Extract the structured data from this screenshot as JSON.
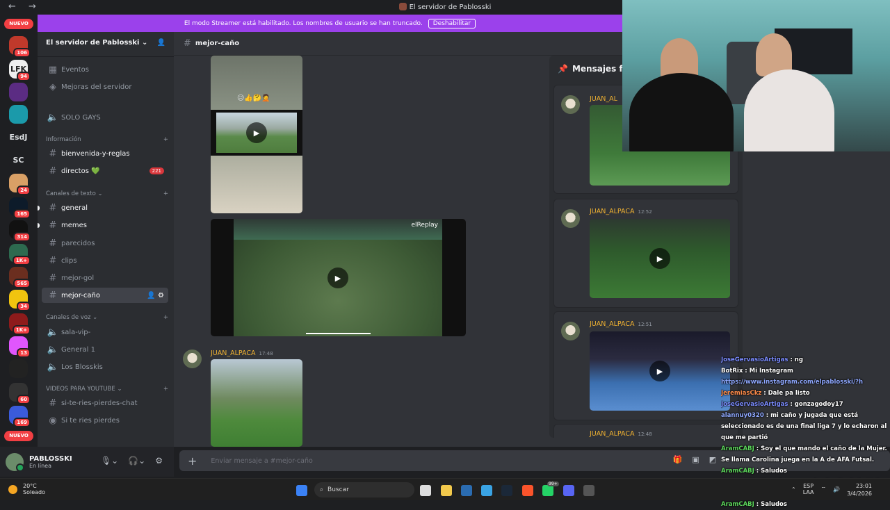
{
  "window": {
    "title": "El servidor de Pablosski",
    "back": "←",
    "forward": "→"
  },
  "guilds": {
    "new_label_top": "NUEVO",
    "new_label_bottom": "NUEVO",
    "items": [
      {
        "label": "",
        "badge": "106",
        "color": "#c0392b"
      },
      {
        "label": "LFK",
        "badge": "94",
        "color": "#eeeeee"
      },
      {
        "label": "",
        "badge": "",
        "color": "#5b2c83"
      },
      {
        "label": "",
        "badge": "",
        "color": "#1b9aaa"
      },
      {
        "label": "EsdJ",
        "badge": "",
        "color": "#1e1f22"
      },
      {
        "label": "SC",
        "badge": "",
        "color": "#1e1f22"
      },
      {
        "label": "",
        "badge": "24",
        "color": "#d9a066"
      },
      {
        "label": "",
        "badge": "165",
        "color": "#0d1b2a"
      },
      {
        "label": "",
        "badge": "314",
        "color": "#111111"
      },
      {
        "label": "",
        "badge": "1K+",
        "color": "#2d6a4f"
      },
      {
        "label": "",
        "badge": "565",
        "color": "#6b2e1f"
      },
      {
        "label": "",
        "badge": "34",
        "color": "#f1c40f"
      },
      {
        "label": "",
        "badge": "1K+",
        "color": "#8e1b1b"
      },
      {
        "label": "",
        "badge": "13",
        "color": "#e056fd"
      },
      {
        "label": "",
        "badge": "",
        "color": "#222222"
      },
      {
        "label": "",
        "badge": "60",
        "color": "#333333"
      },
      {
        "label": "",
        "badge": "169",
        "color": "#3b5bdb"
      }
    ]
  },
  "server": {
    "name": "El servidor de Pablosski",
    "events": "Eventos",
    "boosts": "Mejoras del servidor",
    "channels_top": [
      {
        "name": "SOLO GAYS",
        "type": "voice"
      }
    ],
    "categories": [
      {
        "name": "Información",
        "channels": [
          {
            "name": "bienvenida-y-reglas",
            "bright": true
          },
          {
            "name": "directos 💚",
            "bright": true,
            "mentions": "221"
          }
        ]
      },
      {
        "name": "Canales de texto",
        "channels": [
          {
            "name": "general",
            "bright": true
          },
          {
            "name": "memes",
            "bright": true
          },
          {
            "name": "parecidos"
          },
          {
            "name": "clips"
          },
          {
            "name": "mejor-gol"
          },
          {
            "name": "mejor-caño",
            "selected": true
          }
        ]
      },
      {
        "name": "Canales de voz",
        "channels": [
          {
            "name": "sala-vip-"
          },
          {
            "name": "General 1"
          },
          {
            "name": "Los Blosskis"
          }
        ]
      },
      {
        "name": "VIDEOS PARA YOUTUBE",
        "channels": [
          {
            "name": "si-te-ries-pierdes-chat"
          },
          {
            "name": "Si te ries pierdes"
          }
        ]
      }
    ]
  },
  "user": {
    "name": "PABLOSSKI",
    "status": "En línea"
  },
  "streamer_banner": {
    "text": "El modo Streamer está habilitado. Los nombres de usuario se han truncado.",
    "button": "Deshabilitar"
  },
  "channel": {
    "name": "mejor-caño",
    "messages": [
      {
        "author": "JUAN_ALPACA",
        "time": "17:48"
      }
    ],
    "video_overlay_logo": "elReplay",
    "emoji_caption": "😥👍🤔🤦"
  },
  "pinned": {
    "title": "Mensajes fija",
    "items": [
      {
        "author": "JUAN_AL",
        "time": ""
      },
      {
        "author": "JUAN_ALPACA",
        "time": "12:52"
      },
      {
        "author": "JUAN_ALPACA",
        "time": "12:51"
      },
      {
        "author": "JUAN_ALPACA",
        "time": "12:48"
      }
    ]
  },
  "composer": {
    "placeholder": "Enviar mensaje a #mejor-caño"
  },
  "stream_chat": [
    {
      "user": "JoseGervasioArtigas",
      "text": " : ng",
      "color": "#7b8cff"
    },
    {
      "user": "BotRix",
      "text": " : Mi Instagram",
      "color": "#ffffff"
    },
    {
      "user": "",
      "text": "https://www.instagram.com/elpablosski/?h",
      "color": "#8fa8ff"
    },
    {
      "user": "JeremiasCkz",
      "text": " : Dale pa listo",
      "color": "#ff8c4a"
    },
    {
      "user": "JoseGervasioArtigas",
      "text": " : gonzagodoy17",
      "color": "#7b8cff"
    },
    {
      "user": "alannuy0320",
      "text": " : mi caño y jugada que está seleccionado es de una final liga 7 y lo echaron al que me partió",
      "color": "#8fa8ff"
    },
    {
      "user": "AramCABJ",
      "text": " : Soy el que mando el caño de la Mujer. Se llama Carolina juega en la A de AFA Futsal.",
      "color": "#5cd65c"
    },
    {
      "user": "AramCABJ",
      "text": " : Saludos",
      "color": "#5cd65c"
    },
    {
      "user": "AramCABJ",
      "text": " : Soy el que mando el caño de la Mujer. Se llama Carolina juega en la A de AFA Futsal.",
      "color": "#5cd65c"
    },
    {
      "user": "AramCABJ",
      "text": " : Saludos",
      "color": "#5cd65c"
    }
  ],
  "taskbar": {
    "weather_temp": "20°C",
    "weather_desc": "Soleado",
    "search": "Buscar",
    "lang1": "ESP",
    "lang2": "LAA",
    "time": "23:01",
    "date": "3/4/2026",
    "notif_badge": "99+"
  }
}
